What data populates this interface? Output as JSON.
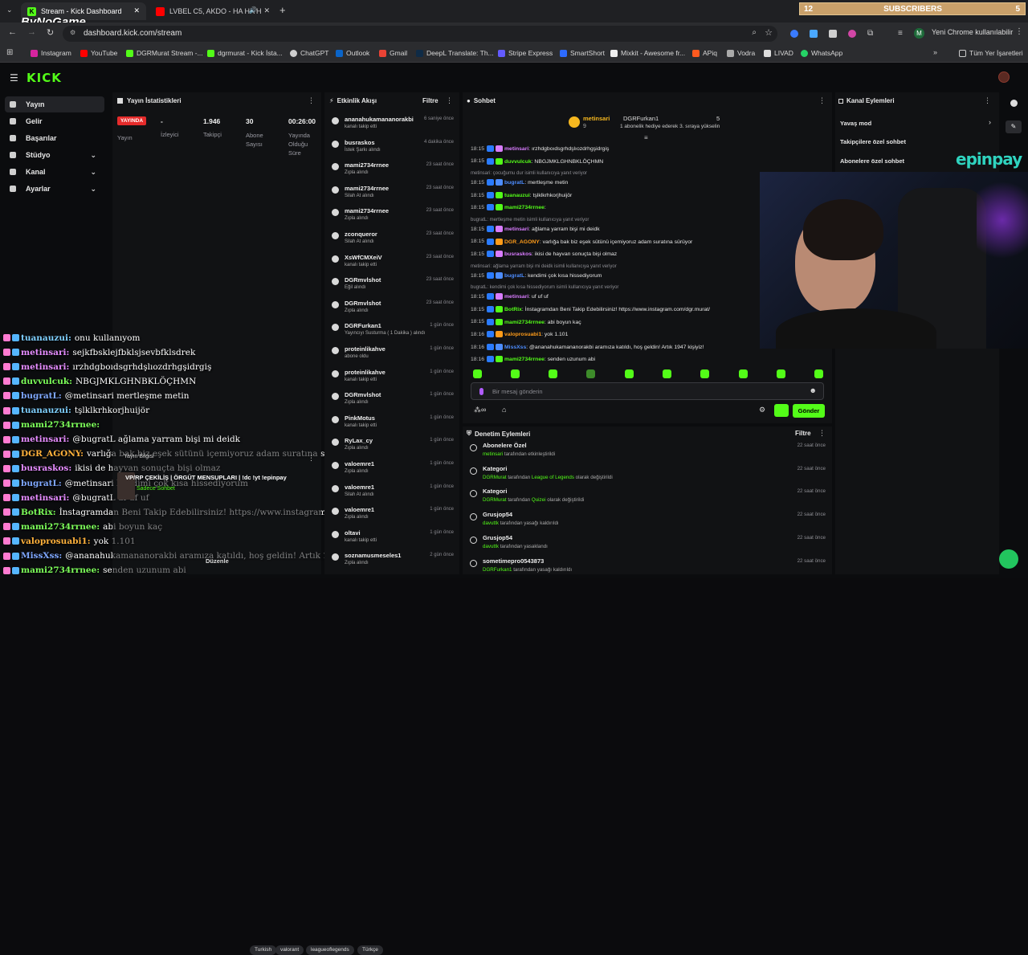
{
  "browser": {
    "tabs": [
      {
        "title": "Stream - Kick Dashboard",
        "active": true
      },
      {
        "title": "LVBEL C5, AKDO - HA HA H",
        "active": false
      }
    ],
    "new_tab": "+",
    "url": "dashboard.kick.com/stream",
    "profile_button": "Yeni Chrome kullanılabilir",
    "profile_initial": "M",
    "bookmarks": [
      "Instagram",
      "YouTube",
      "DGRMurat Stream -...",
      "dgrmurat - Kick İsta...",
      "ChatGPT",
      "Outlook",
      "Gmail",
      "DeepL Translate: Th...",
      "Stripe Express",
      "SmartShort",
      "Mixkit - Awesome fr...",
      "APiq",
      "Vodra",
      "LIVAD",
      "WhatsApp"
    ],
    "all_bookmarks": "Tüm Yer İşaretleri"
  },
  "overlay_top": {
    "brand": "ByNoGame",
    "sub_left": "12",
    "sub_label": "SUBSCRIBERS",
    "sub_right": "5"
  },
  "sidebar": {
    "logo": "KICK",
    "items": [
      {
        "label": "Yayın",
        "active": true,
        "chevron": false
      },
      {
        "label": "Gelir",
        "chevron": false
      },
      {
        "label": "Başarılar",
        "chevron": false
      },
      {
        "label": "Stüdyo",
        "chevron": true
      },
      {
        "label": "Kanal",
        "chevron": true
      },
      {
        "label": "Ayarlar",
        "chevron": true
      }
    ]
  },
  "stats": {
    "title": "Yayın İstatistikleri",
    "badge": "YAYINDA",
    "items": [
      {
        "value": "-",
        "label": "İzleyici"
      },
      {
        "value": "1.946",
        "label": "Takipçi"
      },
      {
        "value": "30",
        "label": "Abone Sayısı"
      },
      {
        "value": "00:26:00",
        "label": "Yayında Olduğu Süre"
      }
    ],
    "status_label": "Yayın"
  },
  "activity": {
    "title": "Etkinlik Akışı",
    "filter": "Filtre",
    "items": [
      {
        "name": "ananahukamananorakbi",
        "sub": "kanalı takip etti",
        "time": "6 saniye önce"
      },
      {
        "name": "busraskos",
        "sub": "İstek Şarkı alındı",
        "time": "4 dakika önce",
        "green": true
      },
      {
        "name": "mami2734rrnee",
        "sub": "Zıpla alındı",
        "time": "23 saat önce",
        "green": true
      },
      {
        "name": "mami2734rrnee",
        "sub": "Silah At alındı",
        "time": "23 saat önce",
        "green": true
      },
      {
        "name": "mami2734rrnee",
        "sub": "Zıpla alındı",
        "time": "23 saat önce",
        "green": true
      },
      {
        "name": "zconqueror",
        "sub": "Silah At alındı",
        "time": "23 saat önce",
        "green": true
      },
      {
        "name": "XsWfCMXeiV",
        "sub": "kanalı takip etti",
        "time": "23 saat önce"
      },
      {
        "name": "DGRmvlshot",
        "sub": "Eğil alındı",
        "time": "23 saat önce",
        "green": true
      },
      {
        "name": "DGRmvlshot",
        "sub": "Zıpla alındı",
        "time": "23 saat önce",
        "green": true
      },
      {
        "name": "DGRFurkan1",
        "sub": "Yayıncıyı Susturma ( 1 Dakika ) alındı",
        "time": "1 gün önce",
        "green": true
      },
      {
        "name": "proteinlikahve",
        "sub": "abone oldu",
        "time": "1 gün önce"
      },
      {
        "name": "proteinlikahve",
        "sub": "kanalı takip etti",
        "time": "1 gün önce"
      },
      {
        "name": "DGRmvlshot",
        "sub": "Zıpla alındı",
        "time": "1 gün önce",
        "green": true
      },
      {
        "name": "PinkMotus",
        "sub": "kanalı takip etti",
        "time": "1 gün önce"
      },
      {
        "name": "RyLax_cy",
        "sub": "Zıpla alındı",
        "time": "1 gün önce",
        "green": true
      },
      {
        "name": "valoemre1",
        "sub": "Zıpla alındı",
        "time": "1 gün önce",
        "green": true
      },
      {
        "name": "valoemre1",
        "sub": "Silah At alındı",
        "time": "1 gün önce",
        "green": true
      },
      {
        "name": "valoemre1",
        "sub": "Zıpla alındı",
        "time": "1 gün önce",
        "green": true
      },
      {
        "name": "oltavi",
        "sub": "kanalı takip etti",
        "time": "1 gün önce"
      },
      {
        "name": "soznamusmeseles1",
        "sub": "Zıpla alındı",
        "time": "2 gün önce",
        "green": true
      }
    ]
  },
  "chat": {
    "title": "Sohbet",
    "pinned": {
      "name": "metinsari",
      "count": "9",
      "gifter": "DGRFurkan1",
      "gift_count": "5",
      "gift_text": "1 abonelik hediye ederek 3. sıraya yükselin"
    },
    "messages": [
      {
        "time": "18:15",
        "name": "metinsari",
        "text": "ırzhdgbоıdsgrhdşlıozdrhgşidrgiş",
        "color": "#d97cff"
      },
      {
        "time": "18:15",
        "name": "duvvulcuk",
        "text": "NBGJMKLGHNBKLÖÇHMN",
        "color": "#53fc18"
      },
      {
        "sys": "metinsari: çocuğumu dur isimli kullanıcıya yanıt veriyor"
      },
      {
        "time": "18:15",
        "name": "bugratL",
        "text": "mertleşme metin",
        "color": "#4d8dff"
      },
      {
        "time": "18:15",
        "name": "tuanauzui",
        "text": "tşlklkrhkorjhuijör",
        "color": "#53fc18"
      },
      {
        "time": "18:15",
        "name": "mami2734rrnee",
        "text": "",
        "color": "#53fc18"
      },
      {
        "sys": "bugratL: mertleşme metin isimli kullanıcıya yanıt veriyor"
      },
      {
        "time": "18:15",
        "name": "metinsari",
        "text": "ağlama yarram bişi mi deidk",
        "color": "#d97cff"
      },
      {
        "time": "18:15",
        "name": "DGR_AGONY",
        "text": "varlığa bak biz eşek sütünü içemiyoruz adam suratına sürüyor",
        "color": "#ff9c1a"
      },
      {
        "time": "18:15",
        "name": "busraskos",
        "text": "ikisi de hayvan sonuçta bişi olmaz",
        "color": "#d97cff"
      },
      {
        "sys": "metinsari: ağlama yarram bişi mi deidk isimli kullanıcıya yanıt veriyor"
      },
      {
        "time": "18:15",
        "name": "bugratL",
        "text": "kendimi çok kısa hissediyorum",
        "color": "#4d8dff"
      },
      {
        "sys": "bugratL: kendimi çok kısa hissediyorum isimli kullanıcıya yanıt veriyor"
      },
      {
        "time": "18:15",
        "name": "metinsari",
        "text": "uf uf uf",
        "color": "#d97cff"
      },
      {
        "time": "18:15",
        "name": "BotRix",
        "text": "İnstagramdan Beni Takip Edebilirsiniz! https://www.instagram.com/dgr.murat/",
        "color": "#53fc18"
      },
      {
        "time": "18:15",
        "name": "mami2734rrnee",
        "text": "abi boyun kaç",
        "color": "#53fc18"
      },
      {
        "time": "18:16",
        "name": "valoprosuabi1",
        "text": "yok 1.101",
        "color": "#ff9c1a"
      },
      {
        "time": "18:16",
        "name": "MissXss",
        "text": "@ananahukamananorakbi aramıza katıldı, hoş geldin! Artık 1947 kişiyiz!",
        "color": "#4d8dff"
      },
      {
        "time": "18:16",
        "name": "mami2734rrnee",
        "text": "senden uzunum abi",
        "color": "#53fc18"
      }
    ],
    "input_placeholder": "Bir mesaj gönderin",
    "send": "Gönder"
  },
  "channel_actions": {
    "title": "Kanal Eylemleri",
    "items": [
      "Yavaş mod",
      "Takipçilere özel sohbet",
      "Abonelere özel sohbet"
    ]
  },
  "mod": {
    "title": "Denetim Eylemleri",
    "filter": "Filtre",
    "items": [
      {
        "name": "Abonelere Özel",
        "sub_user": "metinsari",
        "sub_text": "tarafından etkinleştirildi",
        "sub_value": "",
        "time": "22 saat önce"
      },
      {
        "name": "Kategori",
        "sub_user": "DGRMurat",
        "sub_text": "tarafından",
        "sub_value": "League of Legends",
        "sub_tail": "olarak değiştirildi",
        "time": "22 saat önce"
      },
      {
        "name": "Kategori",
        "sub_user": "DGRMurat",
        "sub_text": "tarafından",
        "sub_value": "Quizei",
        "sub_tail": "olarak değiştirildi",
        "time": "22 saat önce"
      },
      {
        "name": "Grusjop54",
        "sub_user": "davuttk",
        "sub_text": "tarafından yasağı kaldırıldı",
        "sub_value": "",
        "time": "22 saat önce"
      },
      {
        "name": "Grusjop54",
        "sub_user": "davuttk",
        "sub_text": "tarafından yasaklandı",
        "sub_value": "",
        "time": "22 saat önce"
      },
      {
        "name": "sometimepro0543873",
        "sub_user": "DGRFurkan1",
        "sub_text": "tarafından yasağı kaldırıldı",
        "sub_value": "",
        "time": "22 saat önce"
      }
    ]
  },
  "overlay_chat": [
    {
      "name": "tuanauzui:",
      "text": "onu kullanıyom",
      "color": "#7fd0ff"
    },
    {
      "name": "metinsari:",
      "text": "sejkfbsklejfbklsjsevbfklsdrek",
      "color": "#e58cff"
    },
    {
      "name": "metinsari:",
      "text": "ırzhdgbоıdsgrhdşlıozdrhgşidrgiş",
      "color": "#e58cff"
    },
    {
      "name": "duvvulcuk:",
      "text": "NBGJMKLGHNBKLÖÇHMN",
      "color": "#7dff5a"
    },
    {
      "name": "bugratL:",
      "text": "@metinsari mertleşme metin",
      "color": "#7fa8ff"
    },
    {
      "name": "tuanauzui:",
      "text": "tşlklkrhkorjhuijör",
      "color": "#7fd0ff"
    },
    {
      "name": "mami2734rrnee:",
      "text": "",
      "color": "#7dff5a"
    },
    {
      "name": "metinsari:",
      "text": "@bugratL ağlama yarram bişi mi deidk",
      "color": "#e58cff"
    },
    {
      "name": "DGR_AGONY:",
      "text": "varlığa bak biz eşek sütünü içemiyoruz adam suratına sürüyor",
      "color": "#ffb13b"
    },
    {
      "name": "busraskos:",
      "text": "ikisi de hayvan sonuçta bişi olmaz",
      "color": "#e58cff"
    },
    {
      "name": "bugratL:",
      "text": "@metinsari kendimi çok kısa hissediyorum",
      "color": "#7fa8ff"
    },
    {
      "name": "metinsari:",
      "text": "@bugratL uf uf uf",
      "color": "#e58cff"
    },
    {
      "name": "BotRix:",
      "text": "İnstagramdan Beni Takip Edebilirsiniz! https://www.instagram.com/dgr.murat/",
      "color": "#7dff5a"
    },
    {
      "name": "mami2734rrnee:",
      "text": "abi boyun kaç",
      "color": "#7dff5a"
    },
    {
      "name": "valoprosuabi1:",
      "text": "yok 1.101",
      "color": "#ffb13b"
    },
    {
      "name": "MissXss:",
      "text": "@ananahukamananorakbi aramıza katıldı, hoş geldin! Artık 1947 kişiyiz!",
      "color": "#7fa8ff"
    },
    {
      "name": "mami2734rrnee:",
      "text": "senden uzunum abi",
      "color": "#7dff5a"
    }
  ],
  "stream_info": {
    "title": "VP/RP ÇEKİLİŞ | ÖRGÜT MENSUPLARI | !dc !yt !epinpay",
    "sub": "Sadece Sohbet",
    "edit": "Yayın Bilgisi",
    "tags": [
      "Turkish",
      "valorant",
      "leagueoflegends",
      "Türkçe"
    ],
    "edit_btn": "Düzenle"
  },
  "webcam": {
    "brand": "epinpay"
  }
}
